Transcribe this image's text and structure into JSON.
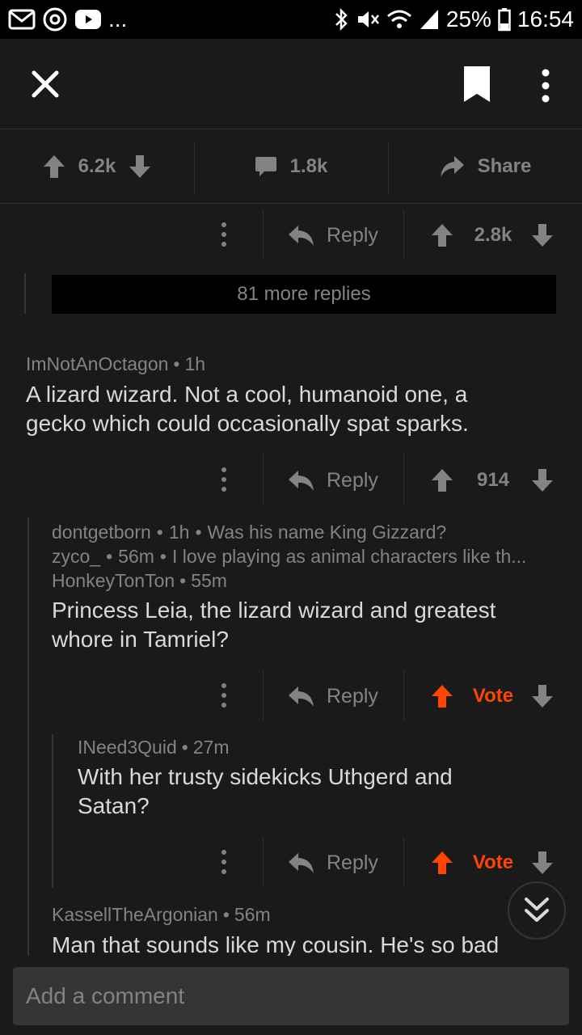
{
  "status_bar": {
    "left_overflow": "...",
    "battery": "25%",
    "time": "16:54"
  },
  "post_bar": {
    "score": "6.2k",
    "comments": "1.8k",
    "share": "Share"
  },
  "more_replies": "81 more replies",
  "reply_label": "Reply",
  "vote_label": "Vote",
  "actions": [
    {
      "score": "2.8k"
    },
    {
      "score": "914"
    }
  ],
  "comments": [
    {
      "author": "ImNotAnOctagon",
      "time": "1h",
      "body_lines": [
        "A lizard wizard. Not a cool, humanoid one, a",
        "gecko which could occasionally spat sparks."
      ]
    },
    {
      "author": "HonkeyTonTon",
      "time": "55m",
      "body_lines": [
        "Princess Leia, the lizard wizard and greatest",
        "whore in Tamriel?"
      ]
    },
    {
      "author": "INeed3Quid",
      "time": "27m",
      "body_lines": [
        "With her trusty sidekicks Uthgerd and",
        "Satan?"
      ]
    },
    {
      "author": "KassellTheArgonian",
      "time": "56m",
      "body_lines": [
        "Man that sounds like my cousin. He's so bad"
      ]
    }
  ],
  "collapsed": [
    {
      "author": "dontgetborn",
      "time": "1h",
      "preview": "Was his name King Gizzard?"
    },
    {
      "author": "zyco_",
      "time": "56m",
      "preview": "I love playing as animal characters like th..."
    }
  ],
  "comment_input": {
    "placeholder": "Add a comment"
  },
  "colors": {
    "background": "#1a1a1b",
    "upvote_accent": "#ff4500",
    "muted": "#818384"
  }
}
